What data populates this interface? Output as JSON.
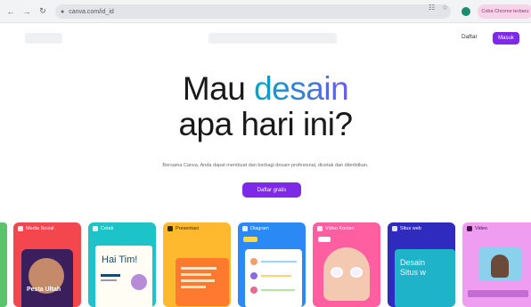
{
  "browser": {
    "back_icon": "back-arrow-icon",
    "forward_icon": "forward-arrow-icon",
    "reload_icon": "reload-icon",
    "url": "canva.com/id_id",
    "promo_chip": "Coba Chrome terbaru"
  },
  "header": {
    "signup_label": "Daftar",
    "login_label": "Masuk"
  },
  "hero": {
    "title_line1_prefix": "Mau ",
    "title_line1_accent": "desain",
    "title_line2": "apa hari ini?",
    "subtitle": "Bersama Canva, Anda dapat membuat dan berbagi desain profesional, dicetak dan diterbitkan.",
    "cta_label": "Daftar gratis"
  },
  "cards": [
    {
      "label": "Media Sosial",
      "color": "#f4464d"
    },
    {
      "label": "Cetak",
      "color": "#1cc3c8"
    },
    {
      "label": "Presentasi",
      "color": "#ffb92e"
    },
    {
      "label": "Diagram",
      "color": "#2b89f5"
    },
    {
      "label": "Video Konten",
      "color": "#ff5fa0"
    },
    {
      "label": "Situs web",
      "color": "#2f2bbf"
    },
    {
      "label": "Video",
      "color": "#ee9df0"
    }
  ],
  "card_texts": {
    "social_big": "Pesta Ultah",
    "print_big": "Hai Tim!",
    "web_big": "Desain Situs w"
  },
  "colors": {
    "brand_purple": "#7d2ae8",
    "accent_cyan": "#00a6c7"
  }
}
